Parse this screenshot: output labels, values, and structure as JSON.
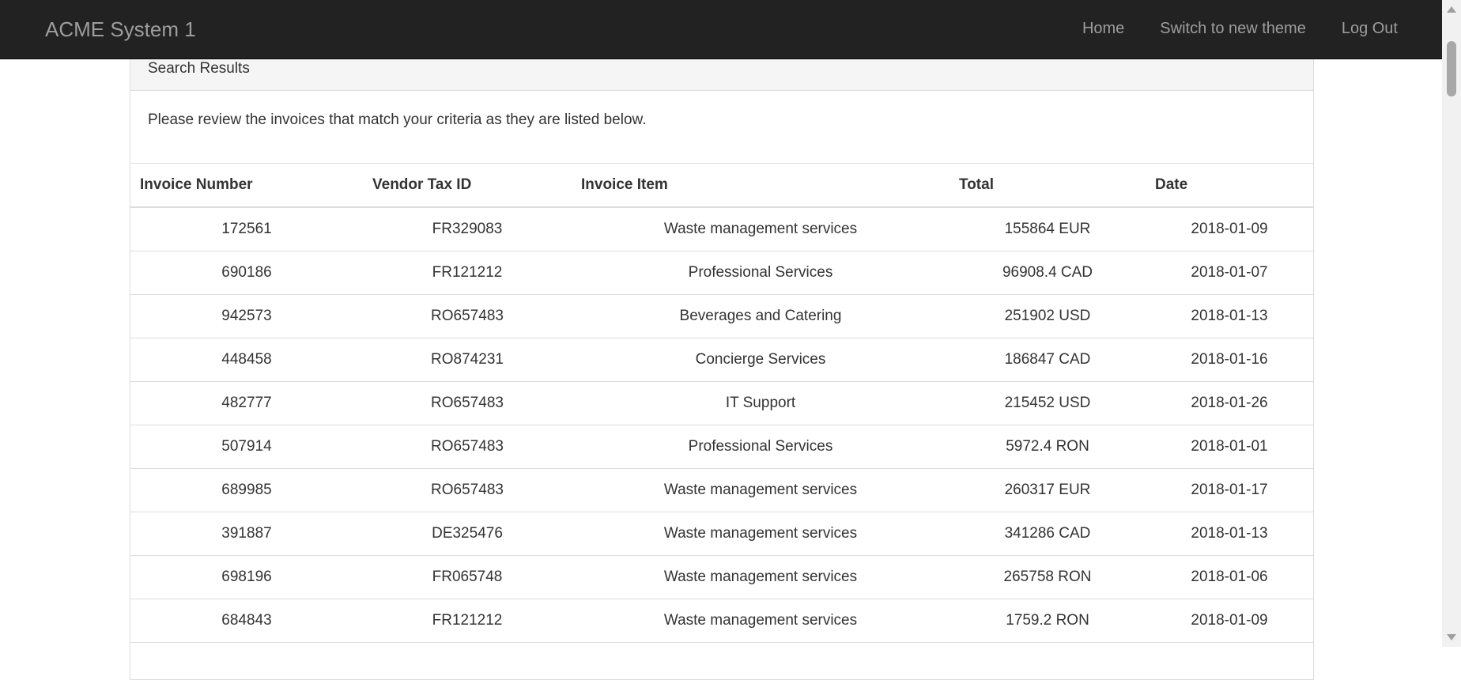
{
  "navbar": {
    "brand": "ACME System 1",
    "links": [
      "Home",
      "Switch to new theme",
      "Log Out"
    ]
  },
  "panel": {
    "heading": "Search Results",
    "intro": "Please review the invoices that match your criteria as they are listed below."
  },
  "table": {
    "columns": [
      "Invoice Number",
      "Vendor Tax ID",
      "Invoice Item",
      "Total",
      "Date"
    ],
    "rows": [
      [
        "172561",
        "FR329083",
        "Waste management services",
        "155864 EUR",
        "2018-01-09"
      ],
      [
        "690186",
        "FR121212",
        "Professional Services",
        "96908.4 CAD",
        "2018-01-07"
      ],
      [
        "942573",
        "RO657483",
        "Beverages and Catering",
        "251902 USD",
        "2018-01-13"
      ],
      [
        "448458",
        "RO874231",
        "Concierge Services",
        "186847 CAD",
        "2018-01-16"
      ],
      [
        "482777",
        "RO657483",
        "IT Support",
        "215452 USD",
        "2018-01-26"
      ],
      [
        "507914",
        "RO657483",
        "Professional Services",
        "5972.4 RON",
        "2018-01-01"
      ],
      [
        "689985",
        "RO657483",
        "Waste management services",
        "260317 EUR",
        "2018-01-17"
      ],
      [
        "391887",
        "DE325476",
        "Waste management services",
        "341286 CAD",
        "2018-01-13"
      ],
      [
        "698196",
        "FR065748",
        "Waste management services",
        "265758 RON",
        "2018-01-06"
      ],
      [
        "684843",
        "FR121212",
        "Waste management services",
        "1759.2 RON",
        "2018-01-09"
      ]
    ]
  }
}
